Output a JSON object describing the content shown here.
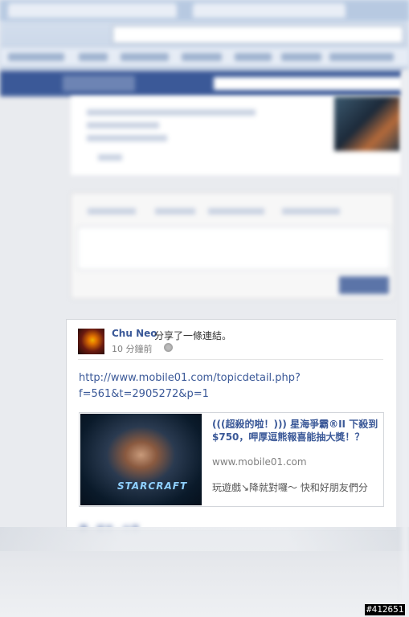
{
  "post": {
    "actor": "Chu Neo",
    "action": "分享了一條連結。",
    "time": "10 分鐘前",
    "url_line1": "http://www.mobile01.com/topicdetail.php?",
    "url_line2": "f=561&t=2905272&p=1",
    "attachment": {
      "title": "(((超殺的啦！))) 星海爭霸®II 下殺到$750，呷厚逗熊報喜能抽大獎！？",
      "domain": "www.mobile01.com",
      "description": "玩遊戲↘降就對囉～ 快和好朋友們分",
      "thumb_text": "STARCRAFT"
    },
    "actions": "讚 · 留言 · 分享"
  },
  "watermark": "#412651",
  "colors": {
    "facebook_blue": "#3b5998",
    "link": "#3b5998"
  }
}
